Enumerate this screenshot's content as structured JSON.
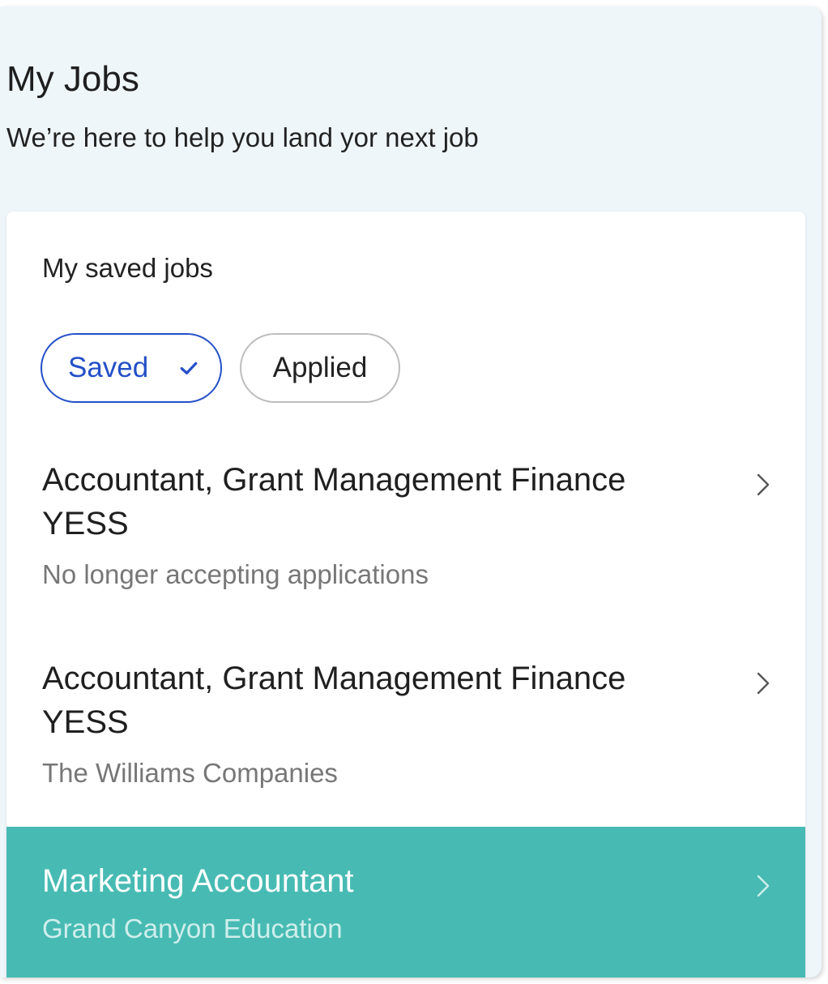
{
  "header": {
    "title": "My Jobs",
    "subtitle": "We’re here to help you land yor next job"
  },
  "card": {
    "title": "My saved jobs",
    "filters": [
      {
        "label": "Saved",
        "selected": true
      },
      {
        "label": "Applied",
        "selected": false
      }
    ]
  },
  "jobs": [
    {
      "title": "Accountant, Grant Management Finance YESS",
      "meta": "No longer accepting applications",
      "highlighted": false
    },
    {
      "title": "Accountant, Grant Management Finance YESS",
      "meta": "The Williams Companies",
      "highlighted": false
    },
    {
      "title": "Marketing Accountant",
      "meta": "Grand Canyon Education",
      "highlighted": true
    }
  ],
  "icons": {
    "selected_filter": "check-icon",
    "row_action": "chevron-right-icon"
  },
  "colors": {
    "page_background": "#eef6fa",
    "accent_blue": "#2450c8",
    "highlight_teal": "#47bbb3"
  }
}
